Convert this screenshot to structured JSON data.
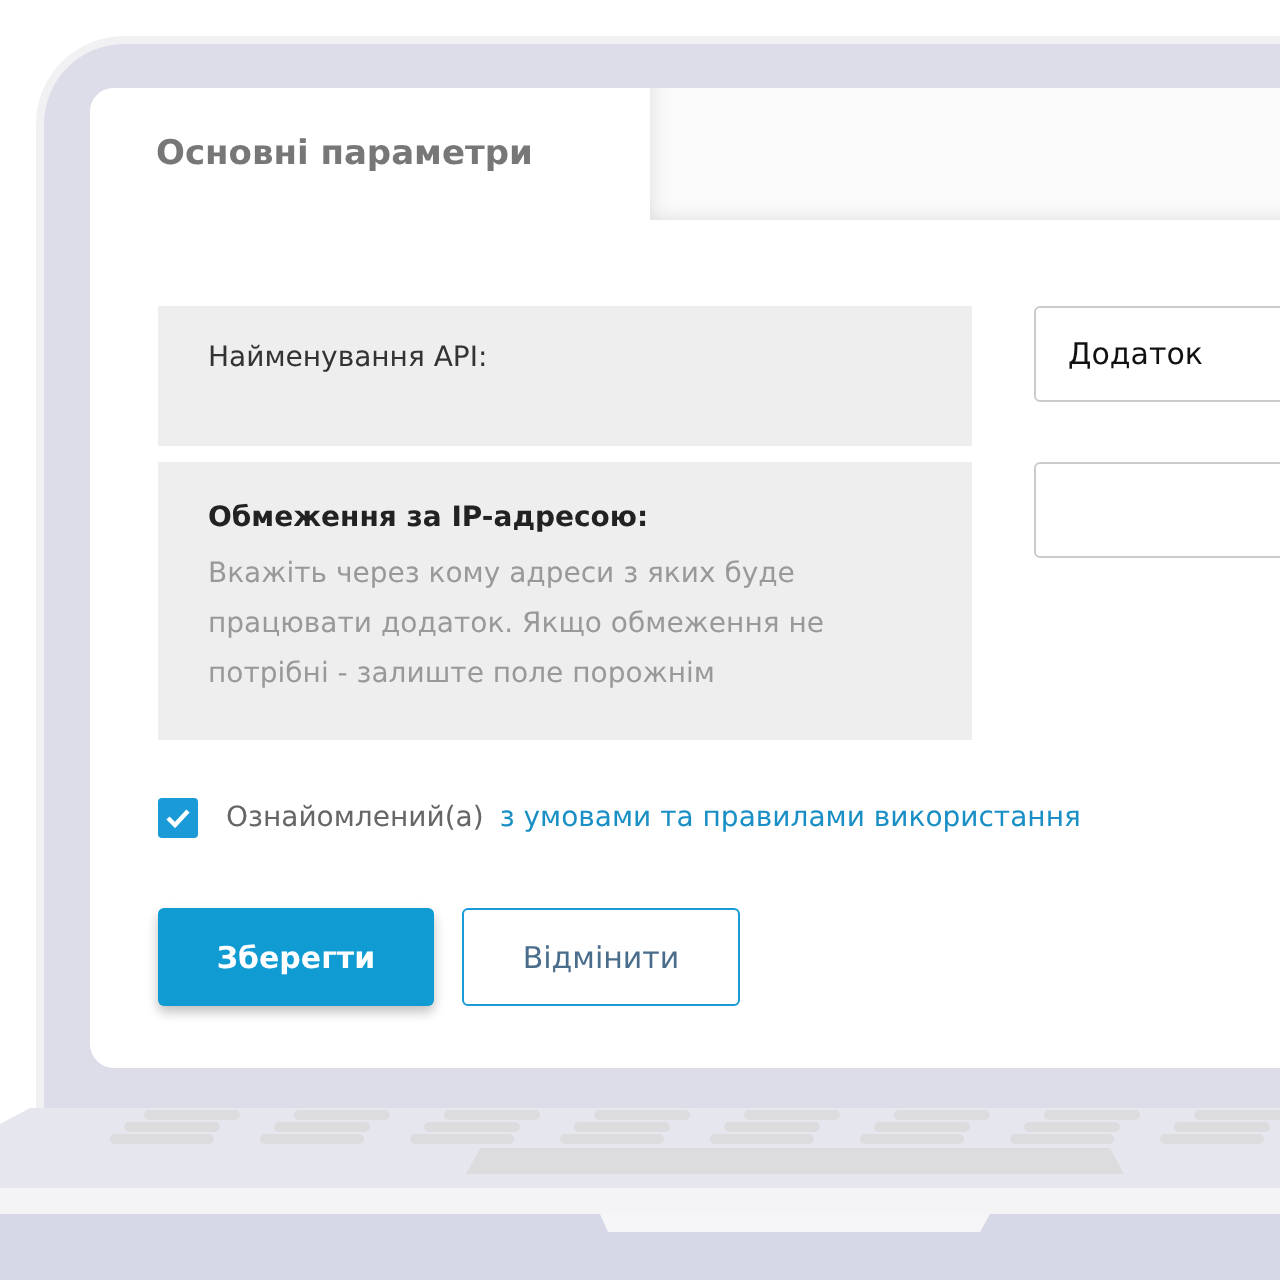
{
  "tab": {
    "label": "Основні параметри",
    "selected": true
  },
  "fields": [
    {
      "label": "Найменування API:",
      "bold": false,
      "value": "Додаток"
    },
    {
      "label": "Обмеження за IP-адресою:",
      "bold": true,
      "hint": "Вкажіть через кому адреси з яких буде працювати додаток. Якщо обмеження не потрібні - залиште поле порожнім"
    }
  ],
  "terms": {
    "checked": true,
    "label": "Ознайомлений(а)",
    "link": "з умовами та правилами використання"
  },
  "buttons": [
    {
      "label": "Зберегти",
      "kind": "primary"
    },
    {
      "label": "Відмінити",
      "kind": "secondary"
    }
  ]
}
